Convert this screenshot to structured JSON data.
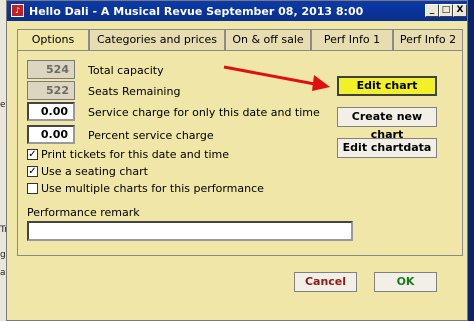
{
  "window": {
    "title": "Hello Dali - A Musical Revue September 08, 2013 8:00",
    "controls": [
      "_",
      "□",
      "X"
    ]
  },
  "tabs": [
    {
      "label": "Options",
      "active": true
    },
    {
      "label": "Categories and prices",
      "active": false
    },
    {
      "label": "On & off sale",
      "active": false
    },
    {
      "label": "Perf Info 1",
      "active": false
    },
    {
      "label": "Perf Info 2",
      "active": false
    }
  ],
  "fields": {
    "total_capacity": {
      "value": "524",
      "label": "Total capacity"
    },
    "seats_remaining": {
      "value": "522",
      "label": "Seats Remaining"
    },
    "service_charge": {
      "value": "0.00",
      "label": "Service charge for only this date and time"
    },
    "percent_service": {
      "value": "0.00",
      "label": "Percent service charge"
    }
  },
  "checkboxes": [
    {
      "label": "Print tickets for this date and time",
      "checked": true
    },
    {
      "label": "Use a seating chart",
      "checked": true
    },
    {
      "label": "Use multiple charts for this performance",
      "checked": false
    }
  ],
  "chart_buttons": {
    "edit_chart": "Edit chart",
    "create_new_chart": "Create new chart",
    "edit_chartdata": "Edit chartdata"
  },
  "remark": {
    "label": "Performance remark",
    "value": ""
  },
  "footer": {
    "cancel": "Cancel",
    "ok": "OK"
  },
  "colors": {
    "title_bar": "#0b3aa8",
    "window_bg": "#f0e6a8",
    "highlight_button": "#f2f027",
    "arrow": "#e01010",
    "cancel_text": "#8b1a1a",
    "ok_text": "#1a7a1a"
  },
  "background_strip": [
    "er",
    "Tr",
    "g",
    "a"
  ]
}
